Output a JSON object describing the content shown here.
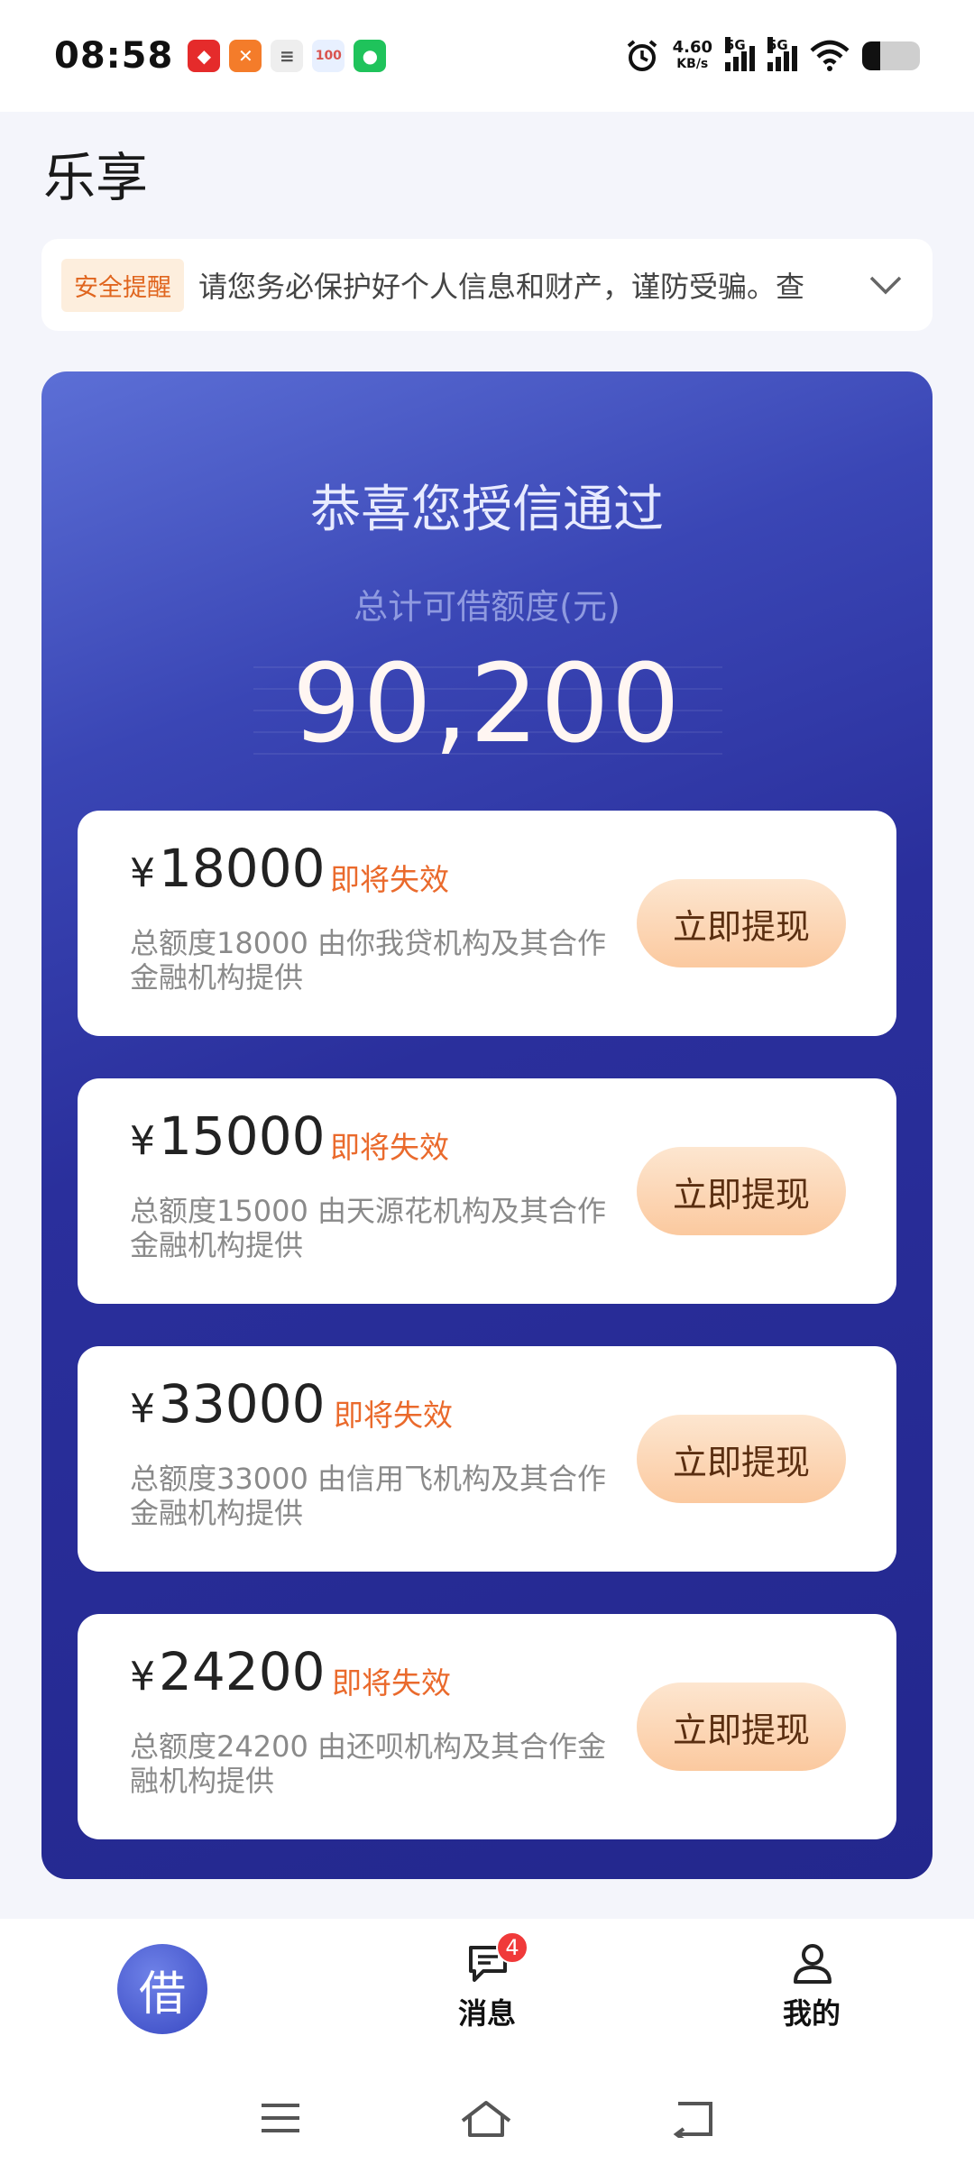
{
  "status_bar": {
    "time": "08:58",
    "net_speed_value": "4.60",
    "net_speed_unit": "KB/s",
    "signal_1": "5G",
    "signal_2": "5G"
  },
  "header": {
    "title": "乐享"
  },
  "notice": {
    "tag": "安全提醒",
    "text": "请您务必保护好个人信息和财产，谨防受骗。查"
  },
  "credit": {
    "headline": "恭喜您授信通过",
    "total_label": "总计可借额度(元)",
    "total_amount": "90,200",
    "offers": [
      {
        "currency": "¥",
        "amount": "18000",
        "status": "即将失效",
        "desc": "总额度18000 由你我贷机构及其合作金融机构提供",
        "button": "立即提现"
      },
      {
        "currency": "¥",
        "amount": "15000",
        "status": "即将失效",
        "desc": "总额度15000 由天源花机构及其合作金融机构提供",
        "button": "立即提现"
      },
      {
        "currency": "¥",
        "amount": "33000",
        "status": "即将失效",
        "desc": "总额度33000 由信用飞机构及其合作金融机构提供",
        "button": "立即提现"
      },
      {
        "currency": "¥",
        "amount": "24200",
        "status": "即将失效",
        "desc": "总额度24200 由还呗机构及其合作金融机构提供",
        "button": "立即提现"
      }
    ]
  },
  "bottom_nav": {
    "borrow": "借",
    "messages": "消息",
    "messages_badge": "4",
    "mine": "我的"
  },
  "colors": {
    "accent": "#3a46b5",
    "expire": "#ea6a2c",
    "button": "#fbc99f"
  }
}
